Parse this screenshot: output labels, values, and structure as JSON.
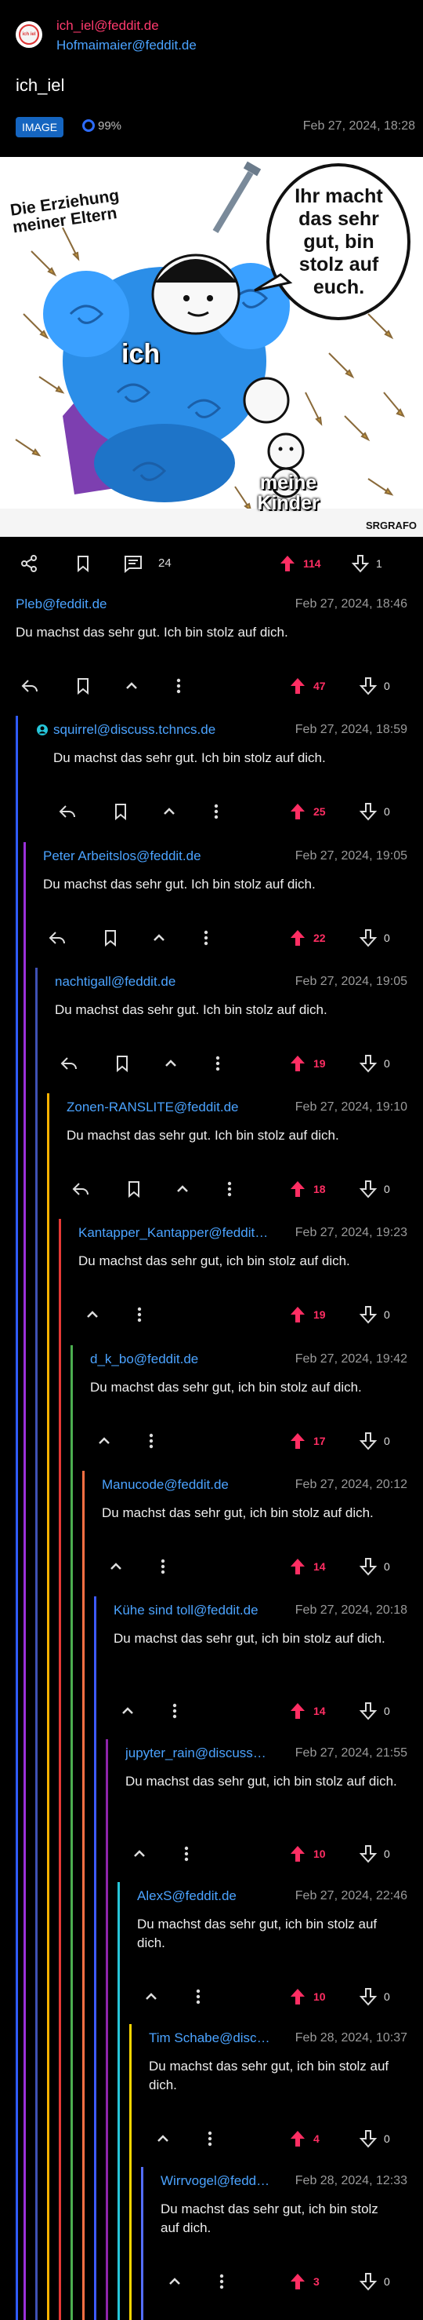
{
  "post": {
    "community": "ich_iel@feddit.de",
    "author": "Hofmaimaier@feddit.de",
    "title": "ich_iel",
    "type_badge": "IMAGE",
    "upvote_ratio": "99%",
    "date": "Feb 27, 2024, 18:28",
    "image": {
      "text_top_left": "Die Erziehung meiner Eltern",
      "speech_bubble": "Ihr macht das sehr gut, bin stolz auf euch.",
      "label_center": "ich",
      "label_bottom_right": "meine Kinder",
      "watermark": "SRGRAFO",
      "corner_logo": "ich iel"
    },
    "comment_count": "24",
    "upvotes": "114",
    "downvotes": "1"
  },
  "comments": [
    {
      "author": "Pleb@feddit.de",
      "date": "Feb 27, 2024, 18:46",
      "body": "Du machst das sehr gut. Ich bin stolz auf dich.",
      "up": "47",
      "down": "0"
    },
    {
      "author": "squirrel@discuss.tchncs.de",
      "date": "Feb 27, 2024, 18:59",
      "body": "Du machst das sehr gut. Ich bin stolz auf dich.",
      "up": "25",
      "down": "0"
    },
    {
      "author": "Peter Arbeitslos@feddit.de",
      "date": "Feb 27, 2024, 19:05",
      "body": "Du machst das sehr gut. Ich bin stolz auf dich.",
      "up": "22",
      "down": "0"
    },
    {
      "author": "nachtigall@feddit.de",
      "date": "Feb 27, 2024, 19:05",
      "body": "Du machst das sehr gut. Ich bin stolz auf dich.",
      "up": "19",
      "down": "0"
    },
    {
      "author": "Zonen-RANSLITE@feddit.de",
      "date": "Feb 27, 2024, 19:10",
      "body": "Du machst das sehr gut. Ich bin stolz auf dich.",
      "up": "18",
      "down": "0"
    },
    {
      "author": "Kantapper_Kantapper@feddit.de",
      "date": "Feb 27, 2024, 19:23",
      "body": "Du machst das sehr gut, ich bin stolz auf dich.",
      "up": "19",
      "down": "0"
    },
    {
      "author": "d_k_bo@feddit.de",
      "date": "Feb 27, 2024, 19:42",
      "body": "Du machst das sehr gut, ich bin stolz auf dich.",
      "up": "17",
      "down": "0"
    },
    {
      "author": "Manucode@feddit.de",
      "date": "Feb 27, 2024, 20:12",
      "body": "Du machst das sehr gut, ich bin stolz auf dich.",
      "up": "14",
      "down": "0"
    },
    {
      "author": "Kühe sind toll@feddit.de",
      "date": "Feb 27, 2024, 20:18",
      "body": "Du machst das sehr gut, ich bin stolz auf dich.",
      "up": "14",
      "down": "0"
    },
    {
      "author": "jupyter_rain@discuss.tchncs.de",
      "date": "Feb 27, 2024, 21:55",
      "body": "Du machst das sehr gut, ich bin stolz auf dich.",
      "up": "10",
      "down": "0"
    },
    {
      "author": "AlexS@feddit.de",
      "date": "Feb 27, 2024, 22:46",
      "body": "Du machst das sehr gut, ich bin stolz auf dich.",
      "up": "10",
      "down": "0"
    },
    {
      "author": "Tim Schabe@discuss.tchncs.de",
      "date": "Feb 28, 2024, 10:37",
      "body": "Du machst das sehr gut, ich bin stolz auf dich.",
      "up": "4",
      "down": "0"
    },
    {
      "author": "Wirrvogel@feddit.de",
      "date": "Feb 28, 2024, 12:33",
      "body": "Du machst das sehr gut, ich bin stolz auf dich.",
      "up": "3",
      "down": "0"
    }
  ],
  "colors": {
    "accent_link": "#4ba3ff",
    "upvote": "#ff2e63",
    "community": "#ff3a6e",
    "badge": "#1565c0",
    "thread_lines": [
      "#2f5bff",
      "#9b30d9",
      "#3f51b5",
      "#ffb300",
      "#e53935",
      "#4caf50",
      "#ff7043",
      "#3d5afe",
      "#8e24aa",
      "#26c6da",
      "#ffd600",
      "#536dfe"
    ]
  }
}
